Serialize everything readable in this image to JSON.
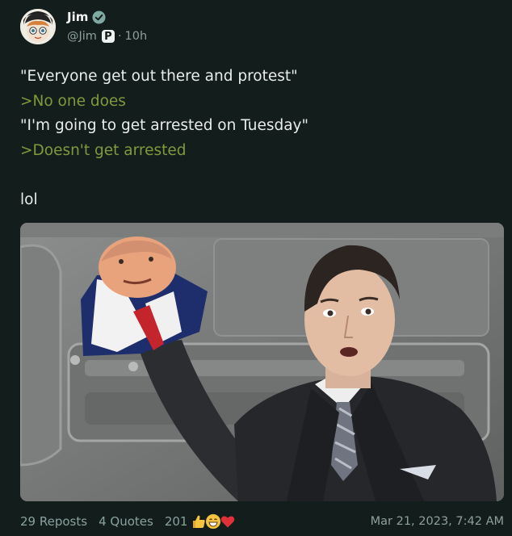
{
  "author": {
    "display_name": "Jim",
    "handle": "@Jim",
    "badge_letter": "P",
    "separator": "·",
    "time_ago": "10h",
    "verified_icon": "verified-check-icon"
  },
  "post": {
    "lines": [
      {
        "text": "\"Everyone get out there and protest\"",
        "style": "normal"
      },
      {
        "text": ">No one does",
        "style": "greentext"
      },
      {
        "text": "\"I'm going to get arrested on Tuesday\"",
        "style": "normal"
      },
      {
        "text": ">Doesn't get arrested",
        "style": "greentext"
      },
      {
        "text": "lol",
        "style": "normal"
      }
    ]
  },
  "footer": {
    "repost_count": "29",
    "repost_label": "Reposts",
    "quote_count": "4",
    "quote_label": "Quotes",
    "reaction_count": "201",
    "reaction_icons": [
      "thumbs-up-icon",
      "grinning-face-icon",
      "heart-icon"
    ],
    "timestamp": "Mar 21, 2023, 7:42 AM"
  },
  "colors": {
    "background": "#131d1b",
    "greentext": "#7f9a3d",
    "verified": "#7fa9a3",
    "muted": "#8aa29e"
  }
}
